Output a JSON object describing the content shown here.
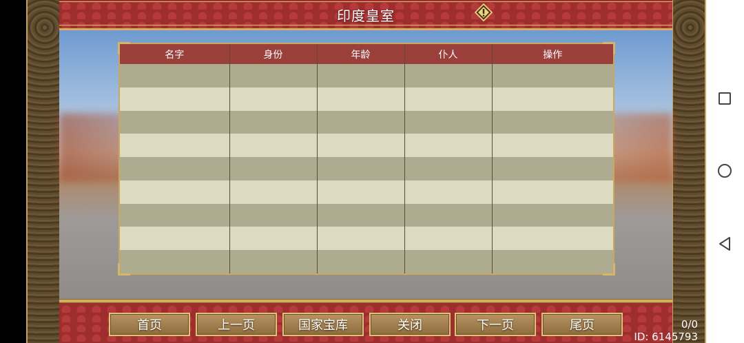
{
  "title": "印度皇室",
  "table": {
    "columns": [
      "名字",
      "身份",
      "年龄",
      "仆人",
      "操作"
    ],
    "row_count": 9
  },
  "buttons": {
    "first_page": "首页",
    "prev_page": "上一页",
    "treasury": "国家宝库",
    "close": "关闭",
    "next_page": "下一页",
    "last_page": "尾页"
  },
  "page_count": "0/0",
  "user_id": "ID: 6145793",
  "icons": {
    "warning": "warning-icon",
    "nav_recent": "square-icon",
    "nav_home": "circle-icon",
    "nav_back": "triangle-back-icon"
  },
  "colors": {
    "header_red": "#9b3f3a",
    "gold": "#d6b062",
    "row_dark": "#adab90",
    "row_light": "#dcdac0"
  }
}
